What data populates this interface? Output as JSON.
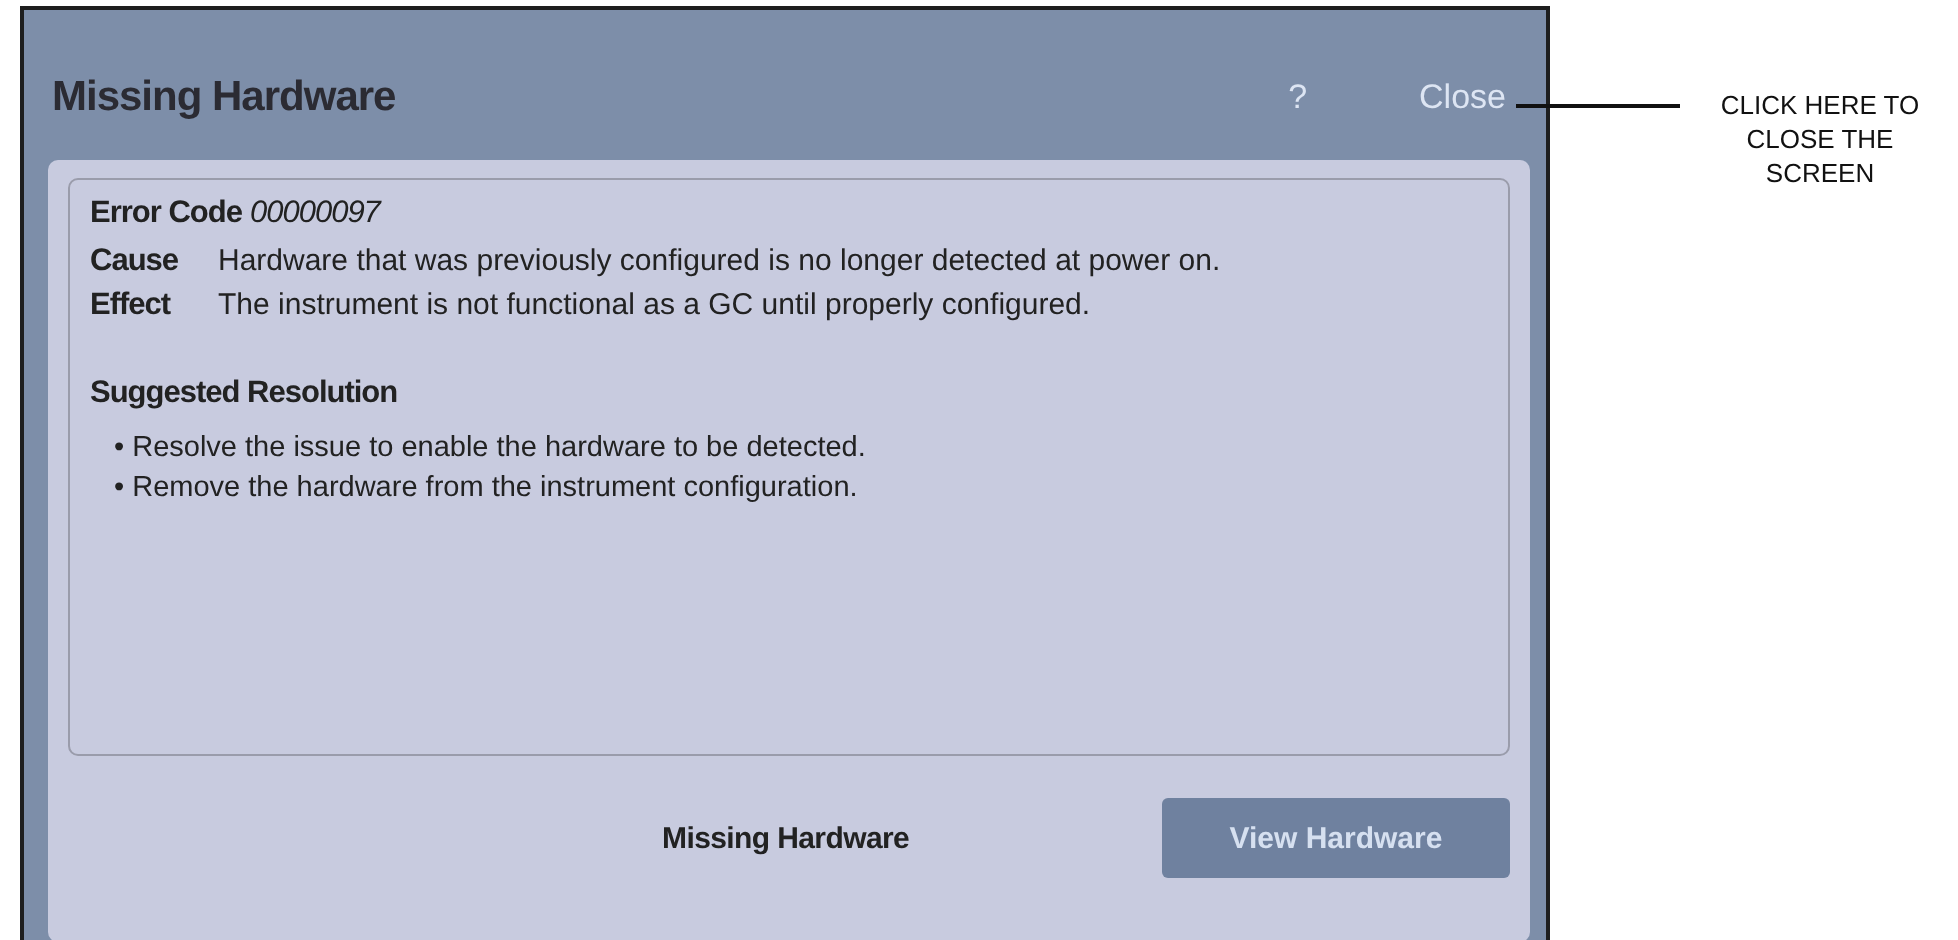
{
  "dialog": {
    "title": "Missing Hardware",
    "help": "?",
    "close": "Close",
    "error_code_label": "Error Code",
    "error_code": "00000097",
    "details": [
      {
        "label": "Cause",
        "text": "Hardware that was previously configured is no longer detected at power on."
      },
      {
        "label": "Effect",
        "text": "The instrument is not functional as a GC until properly configured."
      }
    ],
    "resolution_title": "Suggested Resolution",
    "resolution_items": [
      "• Resolve the issue to enable the hardware to be detected.",
      "• Remove the hardware from the instrument configuration."
    ],
    "footer_label": "Missing Hardware",
    "button": {
      "label": "View Hardware",
      "disabled": true
    }
  },
  "annotation": {
    "text": "CLICK HERE TO CLOSE THE SCREEN"
  }
}
